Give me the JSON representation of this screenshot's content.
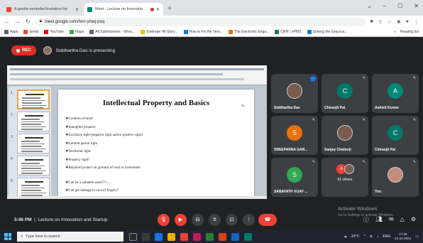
{
  "browser": {
    "tabs": [
      {
        "label": "A gentle reminder/Invitation for",
        "color": "#ea4335",
        "active": false
      },
      {
        "label": "Meet - Lecture on Innovatio",
        "color": "#00897b",
        "active": true
      }
    ],
    "url": "meet.google.com/hnn-yrwq-poq",
    "bookmarks": [
      {
        "label": "Apps",
        "color": "#5f6368"
      },
      {
        "label": "Gmail",
        "color": "#ea4335"
      },
      {
        "label": "YouTube",
        "color": "#ff0000"
      },
      {
        "label": "Maps",
        "color": "#34a853"
      },
      {
        "label": "All Submissions - Wora...",
        "color": "#5f6368"
      },
      {
        "label": "Zoetrope Hil-Story...",
        "color": "#fbbc04"
      },
      {
        "label": "How to Fix the Vers...",
        "color": "#1a73e8"
      },
      {
        "label": "The Electronic Enga...",
        "color": "#e37400"
      },
      {
        "label": "CRIF | ePMS",
        "color": "#188038"
      },
      {
        "label": "Solving the Graysca...",
        "color": "#1a73e8"
      }
    ],
    "reading_list": "Reading list"
  },
  "meet": {
    "rec_label": "REC",
    "presenting_text": "Siddhartha Das is presenting",
    "time": "5:46 PM",
    "meeting_title": "Lecture on Innovation and Startup"
  },
  "slide": {
    "title": "Intellectual Property and Basics",
    "bullets": [
      "Creation of mind",
      "Intangible property",
      "Exclusive right (negative right and/or positive right)",
      "Limited period right",
      "Territorial right",
      "Property right?",
      "Required protect on grounds of trust or investment",
      "Can be a valuable asset???.....",
      "Can get damage in case of forgery?"
    ],
    "thumb_numbers": [
      "1",
      "2",
      "3",
      "4",
      "5"
    ]
  },
  "participants": [
    {
      "name": "Siddhartha Das",
      "initial": "",
      "color": "#7a5c4f",
      "photo": true,
      "speaking": true
    },
    {
      "name": "Chiranjit Pal",
      "initial": "C",
      "color": "#00796b",
      "photo": false,
      "speaking": false
    },
    {
      "name": "Ashish Kumar",
      "initial": "A",
      "color": "#00897b",
      "photo": false,
      "speaking": false
    },
    {
      "name": "SREEPARNA GAN...",
      "initial": "S",
      "color": "#e8710a",
      "photo": false,
      "speaking": false
    },
    {
      "name": "Sanjay Chatterji",
      "initial": "",
      "color": "#7a5c4f",
      "photo": true,
      "speaking": false
    },
    {
      "name": "Chiranjit Pal",
      "initial": "C",
      "color": "#00796b",
      "photo": false,
      "speaking": false
    },
    {
      "name": "SABAVATH VIJAY ...",
      "initial": "S",
      "color": "#34a853",
      "photo": false,
      "speaking": false
    },
    {
      "name": "61 others",
      "initial": "A",
      "color": "#ea4335",
      "photo": false,
      "speaking": false,
      "group": true
    },
    {
      "name": "You",
      "initial": "",
      "color": "#c48c7a",
      "photo": true,
      "speaking": false
    }
  ],
  "activation": {
    "title": "Activate Windows",
    "subtitle": "Go to Settings to activate Windows."
  },
  "taskbar": {
    "search_placeholder": "Type here to search",
    "weather": "24°C",
    "language": "ENG",
    "time": "17:46",
    "date": "21-12-2021"
  }
}
